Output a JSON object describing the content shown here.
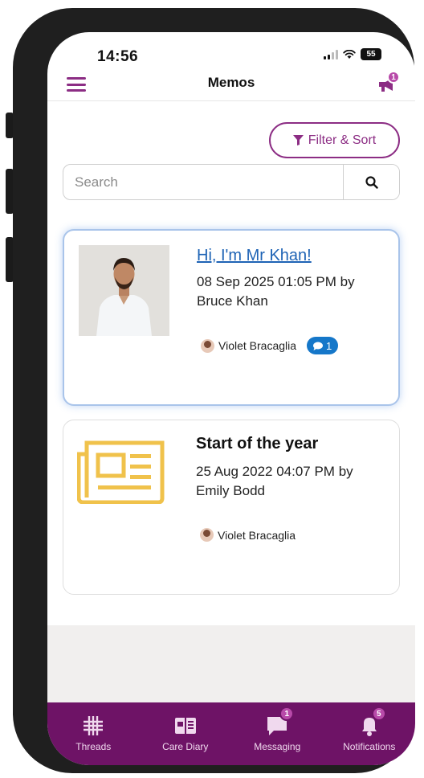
{
  "status_bar": {
    "time": "14:56",
    "battery": "55"
  },
  "nav": {
    "title": "Memos",
    "notification_badge": "1"
  },
  "filter": {
    "label": "Filter & Sort"
  },
  "search": {
    "placeholder": "Search",
    "value": ""
  },
  "memos": [
    {
      "title": "Hi, I'm Mr Khan!",
      "date_by": "08 Sep 2025 01:05 PM by",
      "author": "Bruce Khan",
      "recipient": "Violet Bracaglia",
      "comment_count": "1",
      "thumbnail": "person-photo",
      "selected": true
    },
    {
      "title": "Start of the year",
      "date_by": "25 Aug 2022 04:07 PM by",
      "author": "Emily Bodd",
      "recipient": "Violet Bracaglia",
      "thumbnail": "newspaper-icon",
      "selected": false
    }
  ],
  "tabs": [
    {
      "label": "Threads",
      "icon": "grid-icon"
    },
    {
      "label": "Care Diary",
      "icon": "diary-icon"
    },
    {
      "label": "Messaging",
      "icon": "chat-icon",
      "badge": "1"
    },
    {
      "label": "Notifications",
      "icon": "bell-icon",
      "badge": "5"
    }
  ],
  "colors": {
    "brand": "#6e1366",
    "accent": "#8c2d84",
    "link": "#1e63b5",
    "comment_badge": "#1577c9",
    "newspaper": "#f0c24b"
  }
}
